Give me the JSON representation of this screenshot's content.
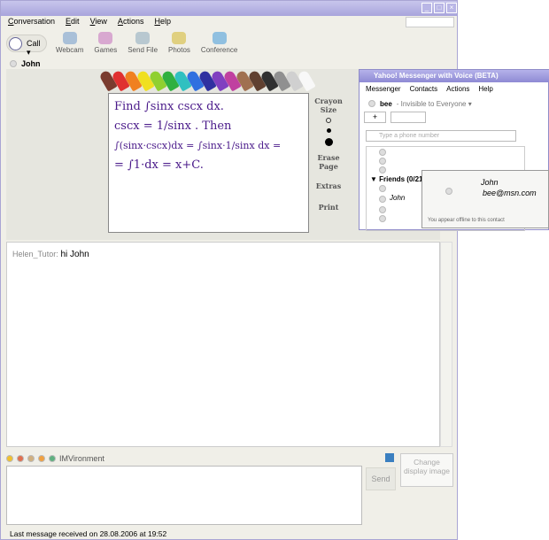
{
  "window": {
    "menu": [
      "Conversation",
      "Edit",
      "View",
      "Actions",
      "Help"
    ],
    "toolbar": {
      "call": "Call",
      "items": [
        "Webcam",
        "Games",
        "Send File",
        "Photos",
        "Conference"
      ]
    },
    "contact": "John"
  },
  "whiteboard": {
    "lines": [
      "Find ∫sinx cscx dx.",
      "cscx = 1/sinx . Then",
      "∫(sinx·cscx)dx = ∫sinx·1/sinx dx =",
      "= ∫1·dx = x+C."
    ],
    "side": {
      "crayon_size": "Crayon Size",
      "erase": "Erase Page",
      "extras": "Extras",
      "print": "Print"
    },
    "crayon_colors": [
      "#7a3b2e",
      "#e03030",
      "#f08020",
      "#f0e020",
      "#90d030",
      "#30b040",
      "#30c0c0",
      "#3070e0",
      "#3030a0",
      "#8040c0",
      "#c040a0",
      "#a07050",
      "#604030",
      "#303030",
      "#909090",
      "#d0d0d0",
      "#f8f8f8"
    ]
  },
  "chat": {
    "sender": "Helen_Tutor:",
    "message": "hi John"
  },
  "compose": {
    "imvironment": "IMVironment",
    "send": "Send",
    "display_image": "Change display image"
  },
  "status": "Last message received on 28.08.2006 at 19:52",
  "yahoo": {
    "title": "Yahoo! Messenger with Voice (BETA)",
    "menu": [
      "Messenger",
      "Contacts",
      "Actions",
      "Help"
    ],
    "user": "bee",
    "status": "- Invisible to Everyone ▾",
    "phone_placeholder": "Type a phone number",
    "group": "Friends (0/21",
    "contact": "John"
  },
  "popup": {
    "name": "John",
    "email": "bee@msn.com",
    "note": "You appear offline to this contact"
  }
}
